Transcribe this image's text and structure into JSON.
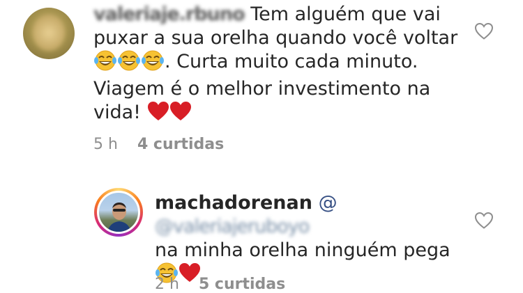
{
  "comment": {
    "username": "valeriaje.rbuno",
    "text_line1": "Tem alguém que vai",
    "text_line2": "puxar a sua orelha quando você voltar",
    "text_line3": ". Curta muito cada minuto.",
    "text_line4": "Viagem é  o melhor investimento na",
    "text_line5": "vida!",
    "time": "5 h",
    "likes": "4 curtidas",
    "emojis": [
      "face-with-tears-of-joy",
      "face-with-tears-of-joy",
      "face-with-tears-of-joy",
      "red-heart",
      "red-heart"
    ]
  },
  "reply": {
    "username": "machadorenan",
    "mention": "@valeriajeruboyo",
    "text": "na minha orelha ninguém pega",
    "time": "2 h",
    "likes": "5 curtidas",
    "emojis": [
      "face-with-tears-of-joy",
      "red-heart"
    ]
  },
  "colors": {
    "text": "#262626",
    "meta": "#8e8e8e",
    "heart_emoji": "#d81e26",
    "emoji_face": "#f6c233"
  }
}
